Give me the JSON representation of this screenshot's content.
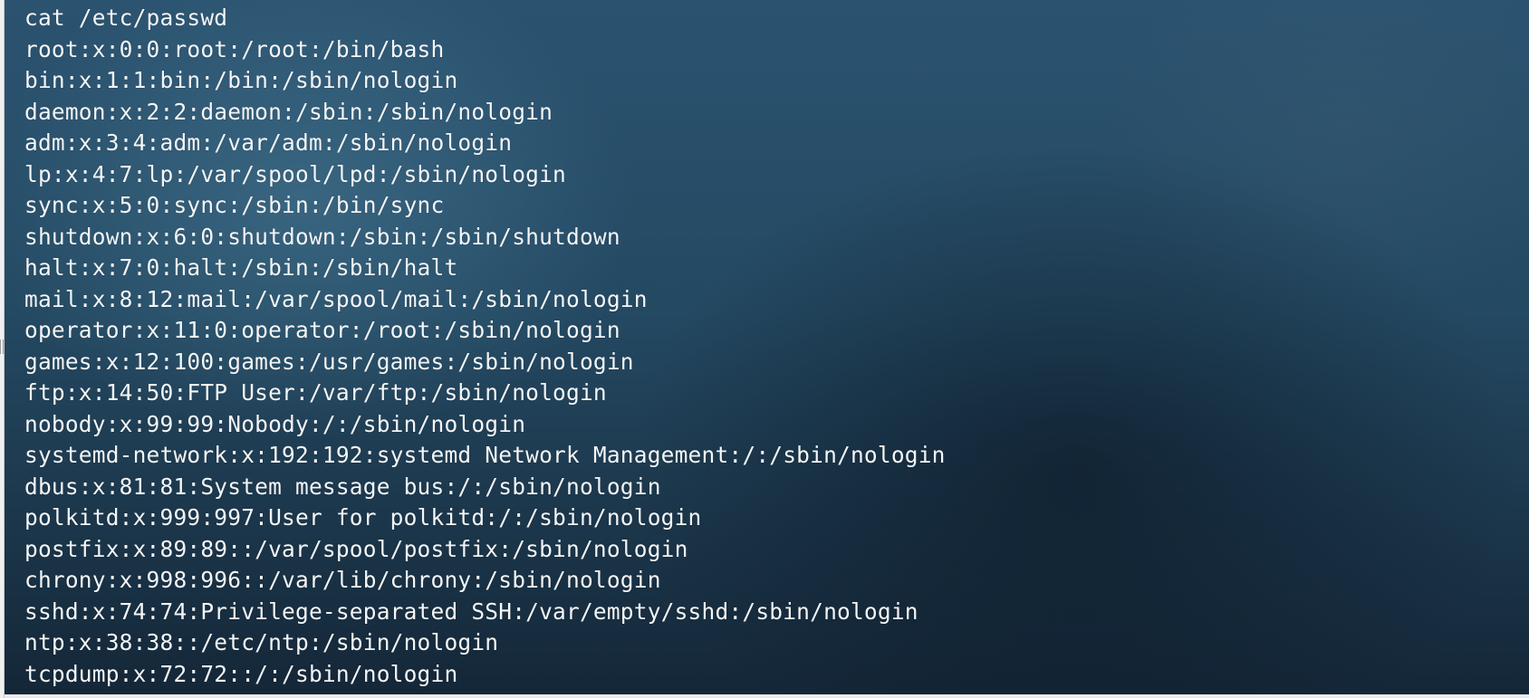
{
  "terminal": {
    "command": "cat /etc/passwd",
    "lines": [
      "root:x:0:0:root:/root:/bin/bash",
      "bin:x:1:1:bin:/bin:/sbin/nologin",
      "daemon:x:2:2:daemon:/sbin:/sbin/nologin",
      "adm:x:3:4:adm:/var/adm:/sbin/nologin",
      "lp:x:4:7:lp:/var/spool/lpd:/sbin/nologin",
      "sync:x:5:0:sync:/sbin:/bin/sync",
      "shutdown:x:6:0:shutdown:/sbin:/sbin/shutdown",
      "halt:x:7:0:halt:/sbin:/sbin/halt",
      "mail:x:8:12:mail:/var/spool/mail:/sbin/nologin",
      "operator:x:11:0:operator:/root:/sbin/nologin",
      "games:x:12:100:games:/usr/games:/sbin/nologin",
      "ftp:x:14:50:FTP User:/var/ftp:/sbin/nologin",
      "nobody:x:99:99:Nobody:/:/sbin/nologin",
      "systemd-network:x:192:192:systemd Network Management:/:/sbin/nologin",
      "dbus:x:81:81:System message bus:/:/sbin/nologin",
      "polkitd:x:999:997:User for polkitd:/:/sbin/nologin",
      "postfix:x:89:89::/var/spool/postfix:/sbin/nologin",
      "chrony:x:998:996::/var/lib/chrony:/sbin/nologin",
      "sshd:x:74:74:Privilege-separated SSH:/var/empty/sshd:/sbin/nologin",
      "ntp:x:38:38::/etc/ntp:/sbin/nologin",
      "tcpdump:x:72:72::/:/sbin/nologin"
    ]
  }
}
